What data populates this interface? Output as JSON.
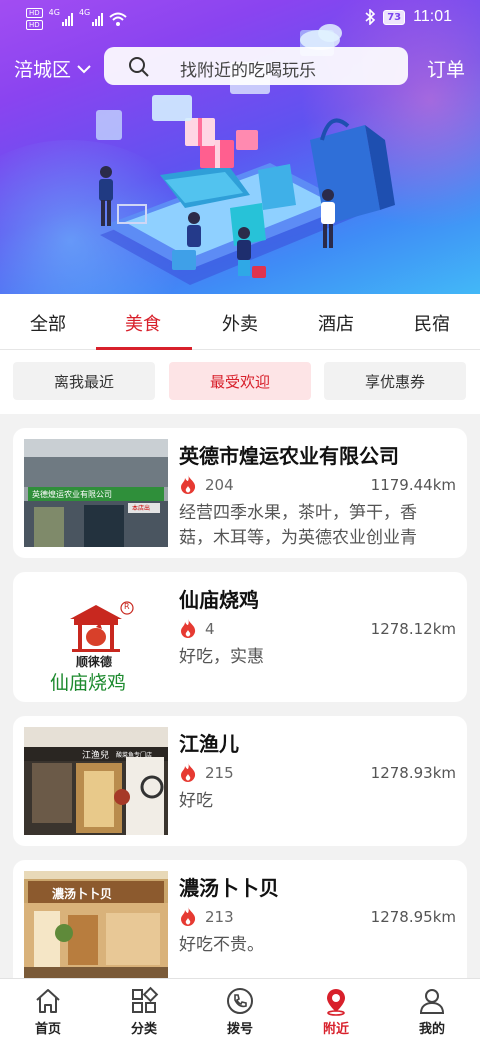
{
  "status_bar": {
    "hd_badge_1": "HD",
    "hd_badge_2": "HD",
    "network_1": "4G",
    "network_2": "4G",
    "battery": "73",
    "time": "11:01"
  },
  "header": {
    "district": "涪城区",
    "search_placeholder": "找附近的吃喝玩乐",
    "orders_label": "订单"
  },
  "category_tabs": [
    {
      "label": "全部",
      "active": false
    },
    {
      "label": "美食",
      "active": true
    },
    {
      "label": "外卖",
      "active": false
    },
    {
      "label": "酒店",
      "active": false
    },
    {
      "label": "民宿",
      "active": false
    }
  ],
  "filters": [
    {
      "label": "离我最近",
      "active": false
    },
    {
      "label": "最受欢迎",
      "active": true
    },
    {
      "label": "享优惠券",
      "active": false
    }
  ],
  "listings": [
    {
      "name": "英德市煌运农业有限公司",
      "heat": "204",
      "distance": "1179.44km",
      "description": "经营四季水果，茶叶，笋干，香菇，木耳等，为英德农业创业青",
      "thumb_sign": "英德煌运农业有限公司",
      "thumb_sub": "本店出"
    },
    {
      "name": "仙庙烧鸡",
      "heat": "4",
      "distance": "1278.12km",
      "description": "好吃，实惠",
      "logo_brand": "顺徕德",
      "logo_name": "仙庙烧鸡",
      "logo_mark": "R"
    },
    {
      "name": "江渔儿",
      "heat": "215",
      "distance": "1278.93km",
      "description": "好吃",
      "thumb_sign": "江渔兒",
      "thumb_sub": "酸菜鱼专门店"
    },
    {
      "name": "濃汤卜卜贝",
      "heat": "213",
      "distance": "1278.95km",
      "description": "好吃不贵。",
      "thumb_sign": "濃汤卜卜贝"
    }
  ],
  "bottom_nav": [
    {
      "label": "首页",
      "icon": "home-icon",
      "active": false
    },
    {
      "label": "分类",
      "icon": "category-icon",
      "active": false
    },
    {
      "label": "拨号",
      "icon": "phone-icon",
      "active": false
    },
    {
      "label": "附近",
      "icon": "location-icon",
      "active": true
    },
    {
      "label": "我的",
      "icon": "user-icon",
      "active": false
    }
  ],
  "colors": {
    "accent": "#d8202b",
    "hero_start": "#a24df2",
    "hero_end": "#42b8f7"
  }
}
